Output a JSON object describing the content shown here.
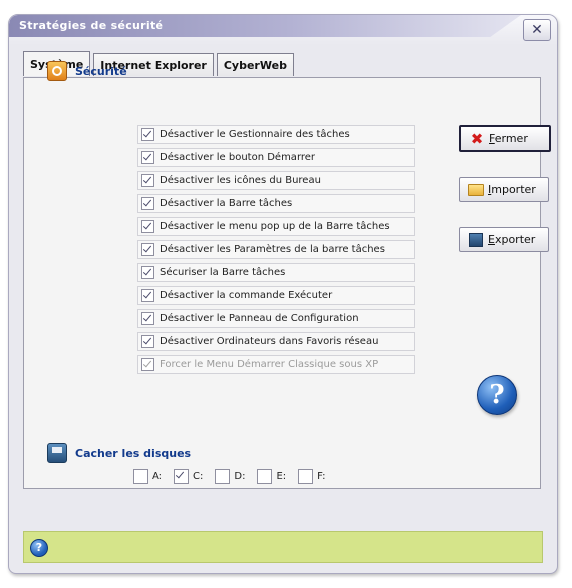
{
  "window": {
    "title": "Stratégies de sécurité",
    "close_label": "✕"
  },
  "tabs": [
    {
      "label": "Système",
      "active": true
    },
    {
      "label": "Internet Explorer",
      "active": false
    },
    {
      "label": "CyberWeb",
      "active": false
    }
  ],
  "security": {
    "title": "Sécurité",
    "options": [
      {
        "label": "Désactiver le Gestionnaire des tâches",
        "checked": true,
        "enabled": true
      },
      {
        "label": "Désactiver le bouton Démarrer",
        "checked": true,
        "enabled": true
      },
      {
        "label": "Désactiver les icônes du Bureau",
        "checked": true,
        "enabled": true
      },
      {
        "label": "Désactiver la Barre tâches",
        "checked": true,
        "enabled": true
      },
      {
        "label": "Désactiver le menu pop up de la Barre tâches",
        "checked": true,
        "enabled": true
      },
      {
        "label": "Désactiver les Paramètres de la barre tâches",
        "checked": true,
        "enabled": true
      },
      {
        "label": "Sécuriser la Barre tâches",
        "checked": true,
        "enabled": true
      },
      {
        "label": "Désactiver la commande Exécuter",
        "checked": true,
        "enabled": true
      },
      {
        "label": "Désactiver le Panneau de Configuration",
        "checked": true,
        "enabled": true
      },
      {
        "label": "Désactiver Ordinateurs dans Favoris réseau",
        "checked": true,
        "enabled": true
      },
      {
        "label": "Forcer le Menu Démarrer Classique sous XP",
        "checked": true,
        "enabled": false
      }
    ]
  },
  "buttons": {
    "close": {
      "accel": "F",
      "rest": "ermer",
      "icon": "close-x-icon"
    },
    "import": {
      "accel": "I",
      "rest": "mporter",
      "icon": "folder-open-icon"
    },
    "export": {
      "accel": "E",
      "rest": "xporter",
      "icon": "floppy-disk-icon"
    }
  },
  "drives": {
    "title": "Cacher les disques",
    "items": [
      {
        "label": "A:",
        "checked": false
      },
      {
        "label": "C:",
        "checked": true
      },
      {
        "label": "D:",
        "checked": false
      },
      {
        "label": "E:",
        "checked": false
      },
      {
        "label": "F:",
        "checked": false
      }
    ]
  },
  "help": {
    "glyph": "?"
  },
  "colors": {
    "title_gradient_start": "#8a89b4",
    "section_title": "#123a8c",
    "status_bar": "#d5e48a",
    "help_blue": "#1f5fb9",
    "close_x": "#d31b1b"
  }
}
